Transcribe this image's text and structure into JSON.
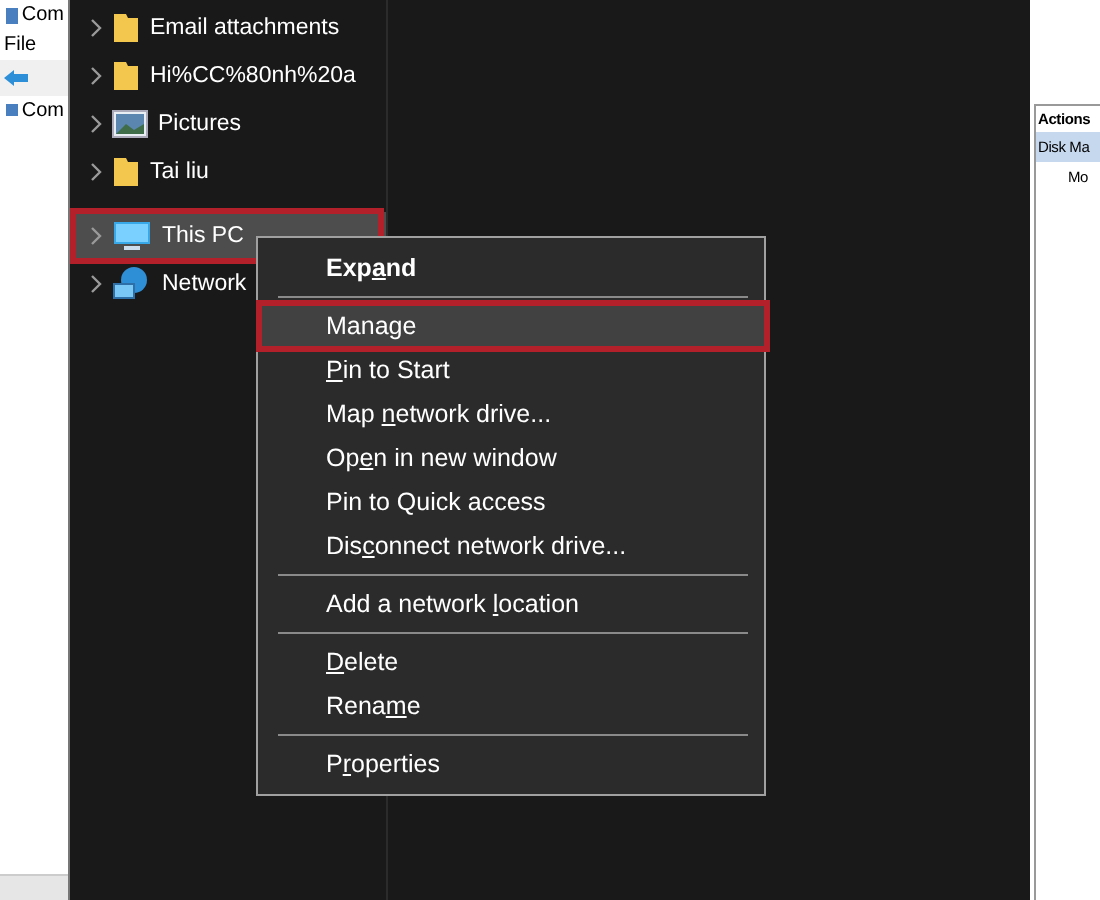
{
  "background_window": {
    "title": "Com",
    "menu": "File",
    "tree_root": "Com"
  },
  "nav_pane": {
    "items": [
      {
        "label": "Email attachments",
        "kind": "folder",
        "selected": false,
        "outlined": false
      },
      {
        "label": "Hi%CC%80nh%20a",
        "kind": "folder",
        "selected": false,
        "outlined": false
      },
      {
        "label": "Pictures",
        "kind": "pictures",
        "selected": false,
        "outlined": false
      },
      {
        "label": "Tai liu",
        "kind": "folder",
        "selected": false,
        "outlined": false
      },
      {
        "label": "This PC",
        "kind": "pc",
        "selected": true,
        "outlined": true
      },
      {
        "label": "Network",
        "kind": "network",
        "selected": false,
        "outlined": false
      }
    ]
  },
  "context_menu": {
    "items": [
      {
        "kind": "item",
        "pre": "Exp",
        "key": "a",
        "post": "nd",
        "default": true,
        "selected": false,
        "outlined": false
      },
      {
        "kind": "separator"
      },
      {
        "kind": "item",
        "pre": "Manage",
        "default": false,
        "selected": true,
        "outlined": true
      },
      {
        "kind": "item",
        "key": "P",
        "post": "in to Start",
        "default": false,
        "selected": false,
        "outlined": false
      },
      {
        "kind": "item",
        "pre": "Map ",
        "key": "n",
        "post": "etwork drive...",
        "default": false,
        "selected": false,
        "outlined": false
      },
      {
        "kind": "item",
        "pre": "Op",
        "key": "e",
        "post": "n in new window",
        "default": false,
        "selected": false,
        "outlined": false
      },
      {
        "kind": "item",
        "pre": "Pin to Quick access",
        "default": false,
        "selected": false,
        "outlined": false
      },
      {
        "kind": "item",
        "pre": "Dis",
        "key": "c",
        "post": "onnect network drive...",
        "default": false,
        "selected": false,
        "outlined": false
      },
      {
        "kind": "separator"
      },
      {
        "kind": "item",
        "pre": "Add a network ",
        "key": "l",
        "post": "ocation",
        "default": false,
        "selected": false,
        "outlined": false
      },
      {
        "kind": "separator"
      },
      {
        "kind": "item",
        "key": "D",
        "post": "elete",
        "default": false,
        "selected": false,
        "outlined": false
      },
      {
        "kind": "item",
        "pre": "Rena",
        "key": "m",
        "post": "e",
        "default": false,
        "selected": false,
        "outlined": false
      },
      {
        "kind": "separator"
      },
      {
        "kind": "item",
        "pre": "P",
        "key": "r",
        "post": "operties",
        "default": false,
        "selected": false,
        "outlined": false
      }
    ]
  },
  "actions_pane": {
    "header": "Actions",
    "selected_item": "Disk Ma",
    "sub_item": "Mo"
  }
}
